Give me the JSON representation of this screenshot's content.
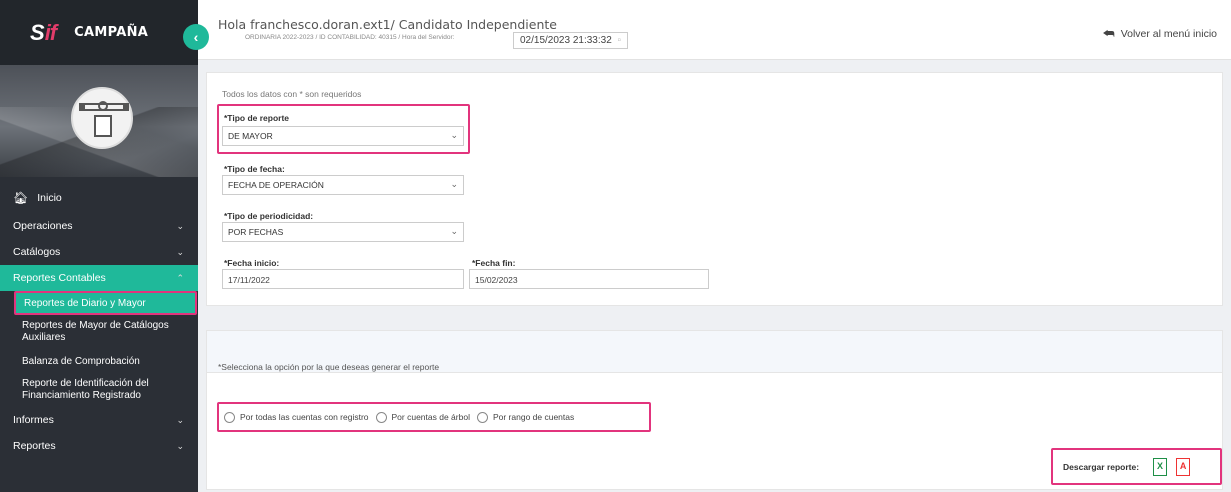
{
  "brand": {
    "logo_s": "S",
    "logo_if": "if",
    "title": "CAMPAÑA"
  },
  "sidebar": {
    "home": "Inicio",
    "items": [
      {
        "label": "Operaciones"
      },
      {
        "label": "Catálogos"
      },
      {
        "label": "Reportes Contables"
      }
    ],
    "sub_items": [
      {
        "label": "Reportes de Diario y Mayor"
      },
      {
        "label": "Reportes de Mayor de Catálogos Auxiliares"
      },
      {
        "label": "Balanza de Comprobación"
      },
      {
        "label": "Reporte de Identificación del Financiamiento Registrado"
      }
    ],
    "bottom_items": [
      {
        "label": "Informes"
      },
      {
        "label": "Reportes"
      }
    ]
  },
  "header": {
    "greeting": "Hola franchesco.doran.ext1/ Candidato Independiente",
    "subline": "ORDINARIA 2022-2023 / ID CONTABILIDAD: 40315 / Hora del Servidor:",
    "datetime": "02/15/2023 21:33:32",
    "back_label": "Volver al menú inicio"
  },
  "form": {
    "required_note": "Todos los datos con * son requeridos",
    "tipo_reporte": {
      "label": "*Tipo de reporte",
      "value": "DE MAYOR"
    },
    "tipo_fecha": {
      "label": "*Tipo de fecha:",
      "value": "FECHA DE OPERACIÓN"
    },
    "tipo_periodicidad": {
      "label": "*Tipo de periodicidad:",
      "value": "POR FECHAS"
    },
    "fecha_inicio": {
      "label": "*Fecha inicio:",
      "value": "17/11/2022"
    },
    "fecha_fin": {
      "label": "*Fecha fin:",
      "value": "15/02/2023"
    }
  },
  "report": {
    "instruction": "*Selecciona la opción por la que deseas generar el reporte",
    "options": [
      "Por todas las cuentas con registro",
      "Por cuentas de árbol",
      "Por rango de cuentas"
    ],
    "download_label": "Descargar reporte:",
    "xls_glyph": "X",
    "pdf_glyph": "A"
  }
}
